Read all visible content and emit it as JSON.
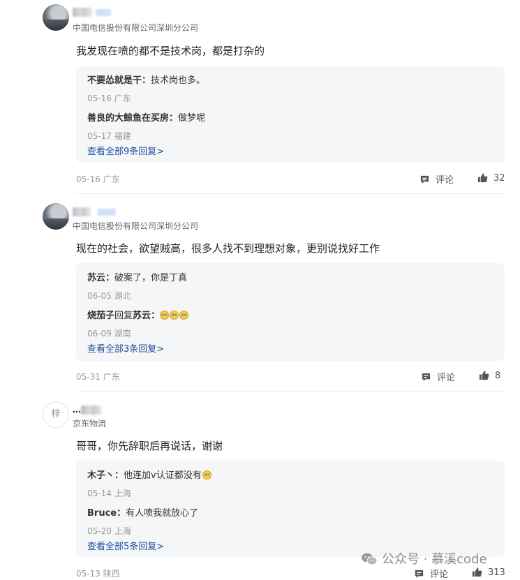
{
  "comments": [
    {
      "company": "中国电信股份有限公司深圳分公司",
      "content": "我发现在喷的都不是技术岗，都是打杂的",
      "replies": [
        {
          "author": "不要怂就是干",
          "sep": "：",
          "text": "技术岗也多。",
          "date": "05-16",
          "location": "广东"
        },
        {
          "author": "善良的大鲸鱼在买房",
          "sep": "：",
          "text": "做梦呢",
          "date": "05-17",
          "location": "福建"
        }
      ],
      "view_all": "查看全部9条回复",
      "view_all_arrow": ">",
      "date": "05-16",
      "location": "广东",
      "comment_label": "评论",
      "likes": "32"
    },
    {
      "company": "中国电信股份有限公司深圳分公司",
      "content": "现在的社会，欲望贼高，很多人找不到理想对象，更别说找好工作",
      "replies": [
        {
          "author": "苏云",
          "sep": "：",
          "text": "破案了，你是丁真",
          "date": "06-05",
          "location": "湖北"
        },
        {
          "author": "烧茄子",
          "mid": "回复",
          "author2": "苏云",
          "sep": "：",
          "text": "",
          "date": "06-09",
          "location": "湖南"
        }
      ],
      "view_all": "查看全部3条回复",
      "view_all_arrow": ">",
      "date": "05-31",
      "location": "广东",
      "comment_label": "评论",
      "likes": "8"
    },
    {
      "name_visible": "…",
      "company": "京东物流",
      "content": "哥哥，你先辞职后再说话，谢谢",
      "replies": [
        {
          "author": "木子丶",
          "sep": "：",
          "text": "他连加v认证都没有",
          "date": "05-14",
          "location": "上海"
        },
        {
          "author": "Bruce",
          "sep": "：",
          "text": "有人喷我就放心了",
          "date": "05-20",
          "location": "上海"
        }
      ],
      "view_all": "查看全部5条回复",
      "view_all_arrow": ">",
      "date": "05-13",
      "location": "陕西",
      "comment_label": "评论",
      "likes": "313"
    }
  ],
  "avatar3_text": "梓",
  "watermark": {
    "text": "公众号 · 慕溪code",
    "icon": "wechat-icon"
  },
  "colors": {
    "link": "#1e50a2",
    "meta": "#999999",
    "reply_bg": "#f5f6f8",
    "emoji": "#f6c945"
  }
}
